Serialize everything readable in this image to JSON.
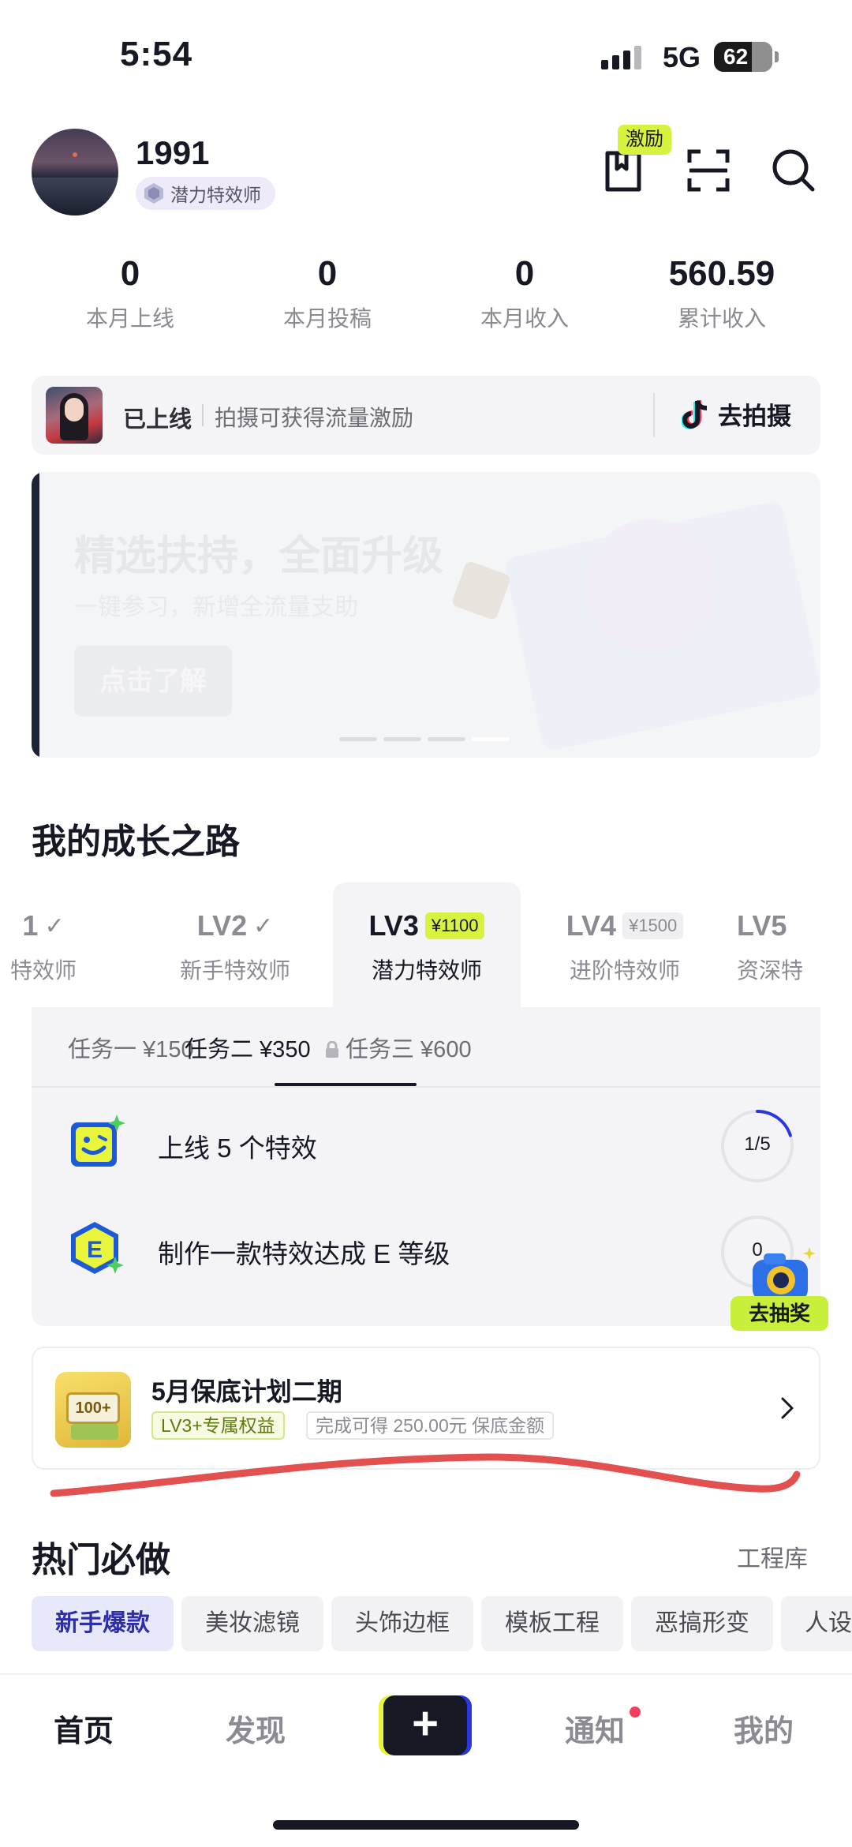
{
  "status_bar": {
    "time": "5:54",
    "network": "5G",
    "battery": "62"
  },
  "profile": {
    "username": "1991",
    "level_badge": "潜力特效师"
  },
  "header": {
    "reward_tag": "激励"
  },
  "stats": [
    {
      "value": "0",
      "label": "本月上线"
    },
    {
      "value": "0",
      "label": "本月投稿"
    },
    {
      "value": "0",
      "label": "本月收入"
    },
    {
      "value": "560.59",
      "label": "累计收入"
    }
  ],
  "online_card": {
    "status": "已上线",
    "hint": "拍摄可获得流量激励",
    "action": "去拍摄"
  },
  "banner": {
    "title": "精选扶持，全面升级",
    "subtitle": "一键参习，新增全流量支助",
    "button": "点击了解",
    "active_slide": 4,
    "slide_count": 4
  },
  "growth": {
    "title": "我的成长之路",
    "levels": [
      {
        "lv": "1",
        "name": "特效师",
        "price": "",
        "done": true
      },
      {
        "lv": "LV2",
        "name": "新手特效师",
        "price": "",
        "done": true
      },
      {
        "lv": "LV3",
        "name": "潜力特效师",
        "price": "¥1100",
        "done": false,
        "active": true
      },
      {
        "lv": "LV4",
        "name": "进阶特效师",
        "price": "¥1500",
        "done": false
      },
      {
        "lv": "LV5",
        "name": "资深特",
        "price": "",
        "done": false
      }
    ],
    "tabs": [
      "任务一 ¥150",
      "任务二 ¥350",
      "任务三 ¥600"
    ],
    "active_tab": 1,
    "tasks": [
      {
        "text": "上线 5 个特效",
        "progress_text": "1/5",
        "progress": 0.2
      },
      {
        "text": "制作一款特效达成 E 等级",
        "progress_text": "0",
        "progress": 0
      }
    ],
    "lottery": "去抽奖"
  },
  "plan": {
    "title": "5月保底计划二期",
    "tag": "LV3+专属权益",
    "desc": "完成可得 250.00元 保底金额",
    "icon_text": "100+"
  },
  "hot": {
    "title": "热门必做",
    "more": "工程库",
    "chips": [
      "新手爆款",
      "美妆滤镜",
      "头饰边框",
      "模板工程",
      "恶搞形变",
      "人设"
    ]
  },
  "nav": {
    "home": "首页",
    "discover": "发现",
    "create": "+",
    "notify": "通知",
    "me": "我的"
  },
  "colors": {
    "accent_lime": "#d9f23f",
    "create_blue": "#2a36e0",
    "notify_dot": "#f23f5f"
  }
}
